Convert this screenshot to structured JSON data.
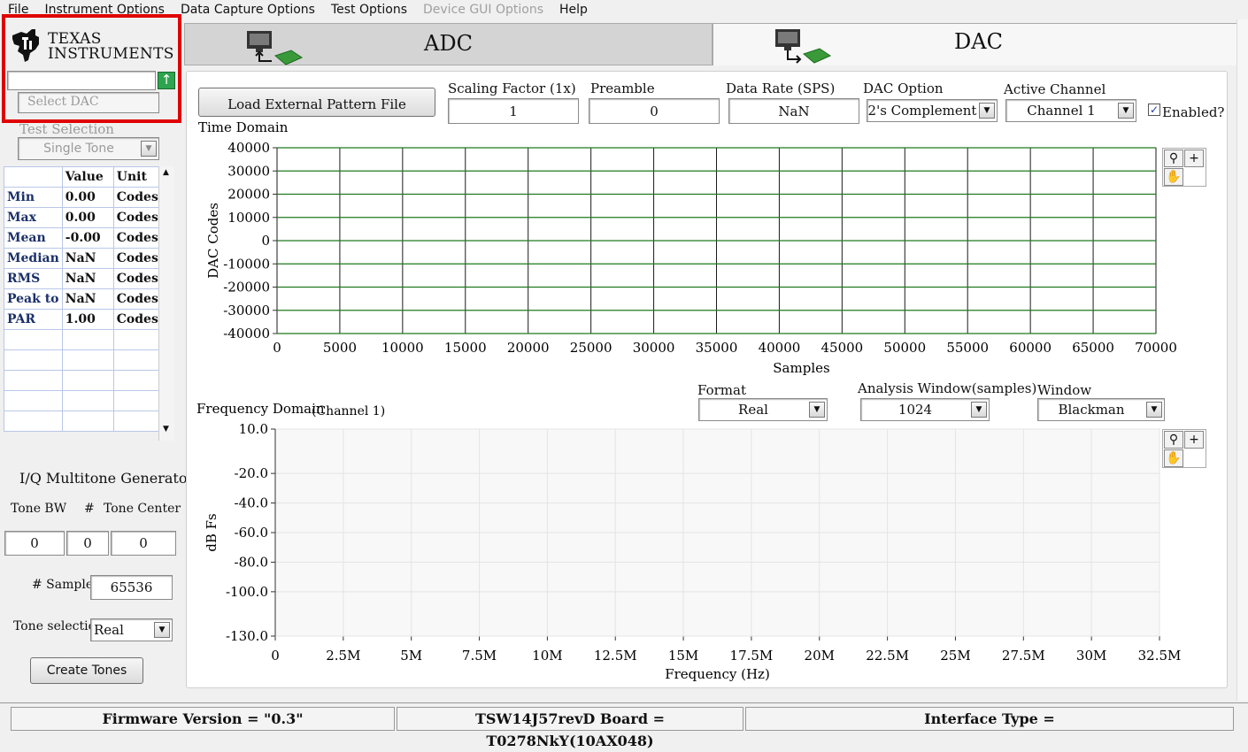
{
  "menu": [
    "File",
    "Instrument Options",
    "Data Capture Options",
    "Test Options",
    "Device GUI Options",
    "Help"
  ],
  "menu_disabled": [
    false,
    false,
    false,
    false,
    true,
    false
  ],
  "logo": {
    "line1": "Texas",
    "line2": "Instruments"
  },
  "device_select": {
    "placeholder": "Select DAC"
  },
  "test_selection": {
    "label": "Test Selection",
    "value": "Single Tone"
  },
  "stats": {
    "headers": [
      "",
      "Value",
      "Unit"
    ],
    "rows": [
      {
        "name": "Min",
        "value": "0.00",
        "unit": "Codes"
      },
      {
        "name": "Max",
        "value": "0.00",
        "unit": "Codes"
      },
      {
        "name": "Mean",
        "value": "-0.00",
        "unit": "Codes"
      },
      {
        "name": "Median",
        "value": "NaN",
        "unit": "Codes"
      },
      {
        "name": "RMS",
        "value": "NaN",
        "unit": "Codes"
      },
      {
        "name": "Peak to l",
        "value": "NaN",
        "unit": "Codes"
      },
      {
        "name": "PAR",
        "value": "1.00",
        "unit": "Codes"
      }
    ]
  },
  "multitone": {
    "title": "I/Q Multitone Generator",
    "tone_bw_label": "Tone BW",
    "count_label": "#",
    "tone_center_label": "Tone Center",
    "tone_bw": "0",
    "count": "0",
    "tone_center": "0",
    "samples_label": "# Samples",
    "samples": "65536",
    "tone_selection_label": "Tone selection",
    "tone_selection": "Real",
    "create_button": "Create Tones"
  },
  "tabs": {
    "adc": "ADC",
    "dac": "DAC"
  },
  "controls": {
    "load_button": "Load External Pattern File",
    "scaling_label": "Scaling Factor (1x)",
    "scaling_value": "1",
    "preamble_label": "Preamble",
    "preamble_value": "0",
    "data_rate_label": "Data Rate (SPS)",
    "data_rate_value": "NaN",
    "dac_option_label": "DAC Option",
    "dac_option_value": "2's Complement",
    "active_channel_label": "Active Channel",
    "active_channel_value": "Channel 1",
    "enabled_label": "Enabled?",
    "enabled_checked": true
  },
  "freq_controls": {
    "format_label": "Format",
    "format_value": "Real",
    "analysis_label": "Analysis Window(samples)",
    "analysis_value": "1024",
    "window_label": "Window",
    "window_value": "Blackman"
  },
  "status": {
    "firmware": "Firmware Version = \"0.3\"",
    "board": "TSW14J57revD Board = T0278NkY(10AX048)",
    "interface": "Interface Type ="
  },
  "chart_data": [
    {
      "type": "line",
      "title": "Time Domain",
      "xlabel": "Samples",
      "ylabel": "DAC Codes",
      "xlim": [
        0,
        70000
      ],
      "ylim": [
        -40000,
        40000
      ],
      "x_ticks": [
        0,
        5000,
        10000,
        15000,
        20000,
        25000,
        30000,
        35000,
        40000,
        45000,
        50000,
        55000,
        60000,
        65000,
        70000
      ],
      "y_ticks": [
        40000,
        30000,
        20000,
        10000,
        0,
        -10000,
        -20000,
        -30000,
        -40000
      ],
      "grid": true,
      "grid_color_x": "#1a1a1a",
      "grid_color_y": "#1e7a1e",
      "series": []
    },
    {
      "type": "line",
      "title": "Frequency Domain",
      "subtitle": "(Channel 1)",
      "xlabel": "Frequency (Hz)",
      "ylabel": "dB Fs",
      "xlim": [
        0,
        32.5
      ],
      "ylim": [
        -130,
        10
      ],
      "x_tick_labels": [
        "0",
        "2.5M",
        "5M",
        "7.5M",
        "10M",
        "12.5M",
        "15M",
        "17.5M",
        "20M",
        "22.5M",
        "25M",
        "27.5M",
        "30M",
        "32.5M"
      ],
      "y_tick_labels": [
        "10.0",
        "-20.0",
        "-40.0",
        "-60.0",
        "-80.0",
        "-100.0",
        "-130.0"
      ],
      "y_ticks": [
        10,
        -20,
        -40,
        -60,
        -80,
        -100,
        -130
      ],
      "grid": true,
      "series": []
    }
  ]
}
